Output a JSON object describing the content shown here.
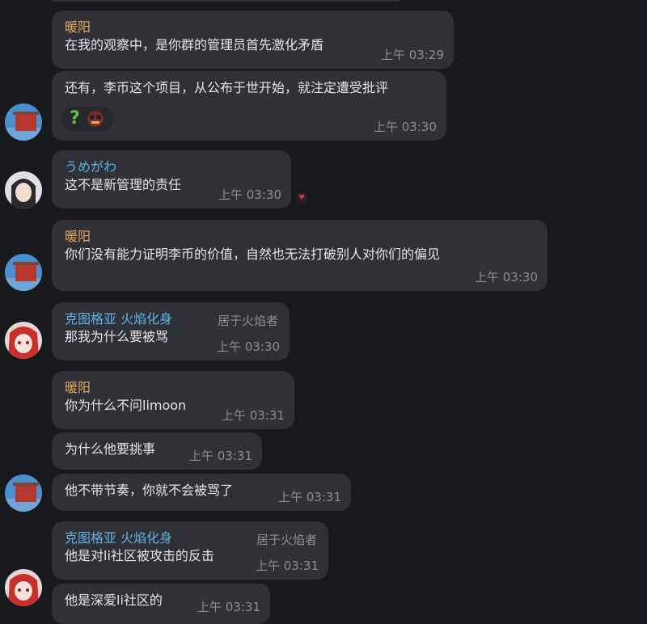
{
  "messages": [
    {
      "name": "暖阳",
      "text": "在我的观察中，是你群的管理员首先激化矛盾",
      "time": "上午 03:29"
    },
    {
      "text": "还有，李币这个项目，从公布于世开始，就注定遭受批评",
      "time": "上午 03:30",
      "reactions": [
        "?",
        "emoji"
      ]
    },
    {
      "name": "うめがわ",
      "text": "这不是新管理的责任",
      "time": "上午 03:30"
    },
    {
      "name": "暖阳",
      "text": "你们没有能力证明李币的价值，自然也无法打破别人对你们的偏见",
      "time": "上午 03:30"
    },
    {
      "name": "克图格亚 火焰化身",
      "rank": "居于火焰者",
      "text": "那我为什么要被骂",
      "time": "上午 03:30"
    },
    {
      "name": "暖阳",
      "text": "你为什么不问limoon",
      "time": "上午 03:31"
    },
    {
      "text": "为什么他要挑事",
      "time": "上午 03:31"
    },
    {
      "text": "他不带节奏，你就不会被骂了",
      "time": "上午 03:31"
    },
    {
      "name": "克图格亚 火焰化身",
      "rank": "居于火焰者",
      "text": "他是对li社区被攻击的反击",
      "time": "上午 03:31"
    },
    {
      "text": "他是深爱li社区的",
      "time": "上午 03:31"
    }
  ],
  "colors": {
    "background": "#18191d",
    "bubble": "#2f3136",
    "name_orange": "#e7a85f",
    "name_blue": "#5cb4e8",
    "timestamp": "#8b8e92"
  }
}
